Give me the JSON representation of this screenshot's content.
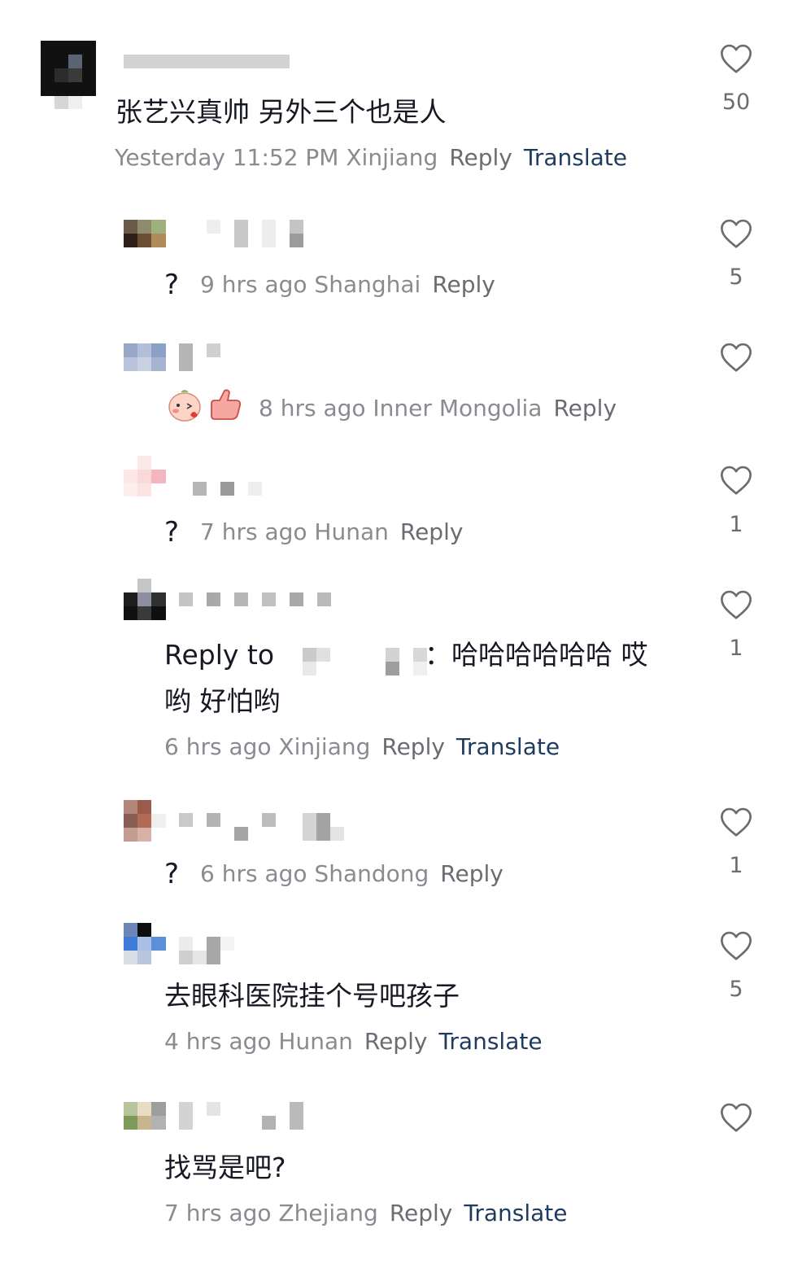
{
  "comments": [
    {
      "text": "张艺兴真帅 另外三个也是人",
      "time": "Yesterday 11:52 PM Xinjiang",
      "reply": "Reply",
      "translate": "Translate",
      "likes": "50"
    }
  ],
  "replies": [
    {
      "text": "?",
      "time": "9 hrs ago Shanghai",
      "reply": "Reply",
      "likes": "5"
    },
    {
      "text": "",
      "time": "8 hrs ago Inner Mongolia",
      "reply": "Reply",
      "likes": ""
    },
    {
      "text": "?",
      "time": "7 hrs ago Hunan",
      "reply": "Reply",
      "likes": "1"
    },
    {
      "text_prefix": "Reply to",
      "text_line1": "：哈哈哈哈哈哈 哎",
      "text_line2": "哟 好怕哟",
      "time": "6 hrs ago Xinjiang",
      "reply": "Reply",
      "translate": "Translate",
      "likes": "1"
    },
    {
      "text": "?",
      "time": "6 hrs ago Shandong",
      "reply": "Reply",
      "likes": "1"
    },
    {
      "text": "去眼科医院挂个号吧孩子",
      "time": "4 hrs ago Hunan",
      "reply": "Reply",
      "translate": "Translate",
      "likes": "5"
    },
    {
      "text": "找骂是吧?",
      "time": "7 hrs ago Zhejiang",
      "reply": "Reply",
      "translate": "Translate",
      "likes": ""
    }
  ],
  "icons": {
    "like": "heart-outline-icon",
    "emoji_1": "blushing-face-emoji",
    "emoji_2": "thumbs-up-emoji"
  },
  "colors": {
    "text": "#161823",
    "meta": "#8a8b91",
    "reply": "#6b6c72",
    "translate": "#1e3a5f"
  }
}
